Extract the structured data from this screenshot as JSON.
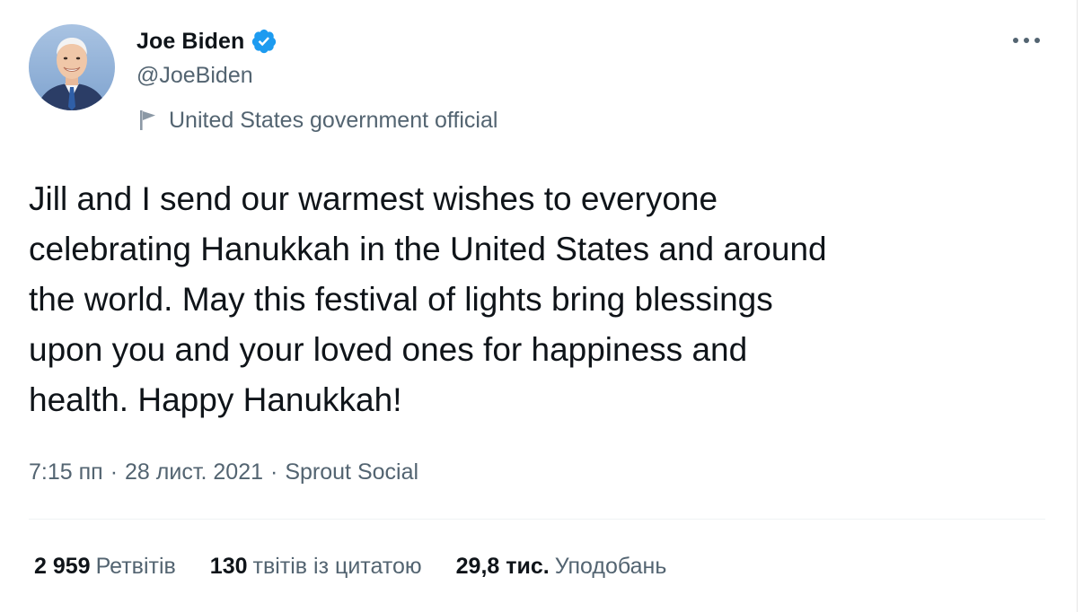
{
  "author": {
    "display_name": "Joe Biden",
    "handle": "@JoeBiden",
    "verified": true,
    "label": "United States government official",
    "avatar_icon": "profile-photo"
  },
  "tweet": {
    "text": "Jill and I send our warmest wishes to everyone\ncelebrating Hanukkah in the United States and around\nthe world. May this festival of lights bring blessings\nupon you and your loved ones for happiness and\nhealth. Happy Hanukkah!",
    "time": "7:15 пп",
    "date": "28 лист. 2021",
    "source": "Sprout Social",
    "separator": "·"
  },
  "stats": {
    "retweets": {
      "count": "2 959",
      "label": "Ретвітів"
    },
    "quotes": {
      "count": "130",
      "label": "твітів із цитатою"
    },
    "likes": {
      "count": "29,8 тис.",
      "label": "Уподобань"
    }
  },
  "colors": {
    "text": "#0f1419",
    "secondary": "#536471",
    "verified": "#1d9bf0",
    "divider": "#eff3f4"
  }
}
